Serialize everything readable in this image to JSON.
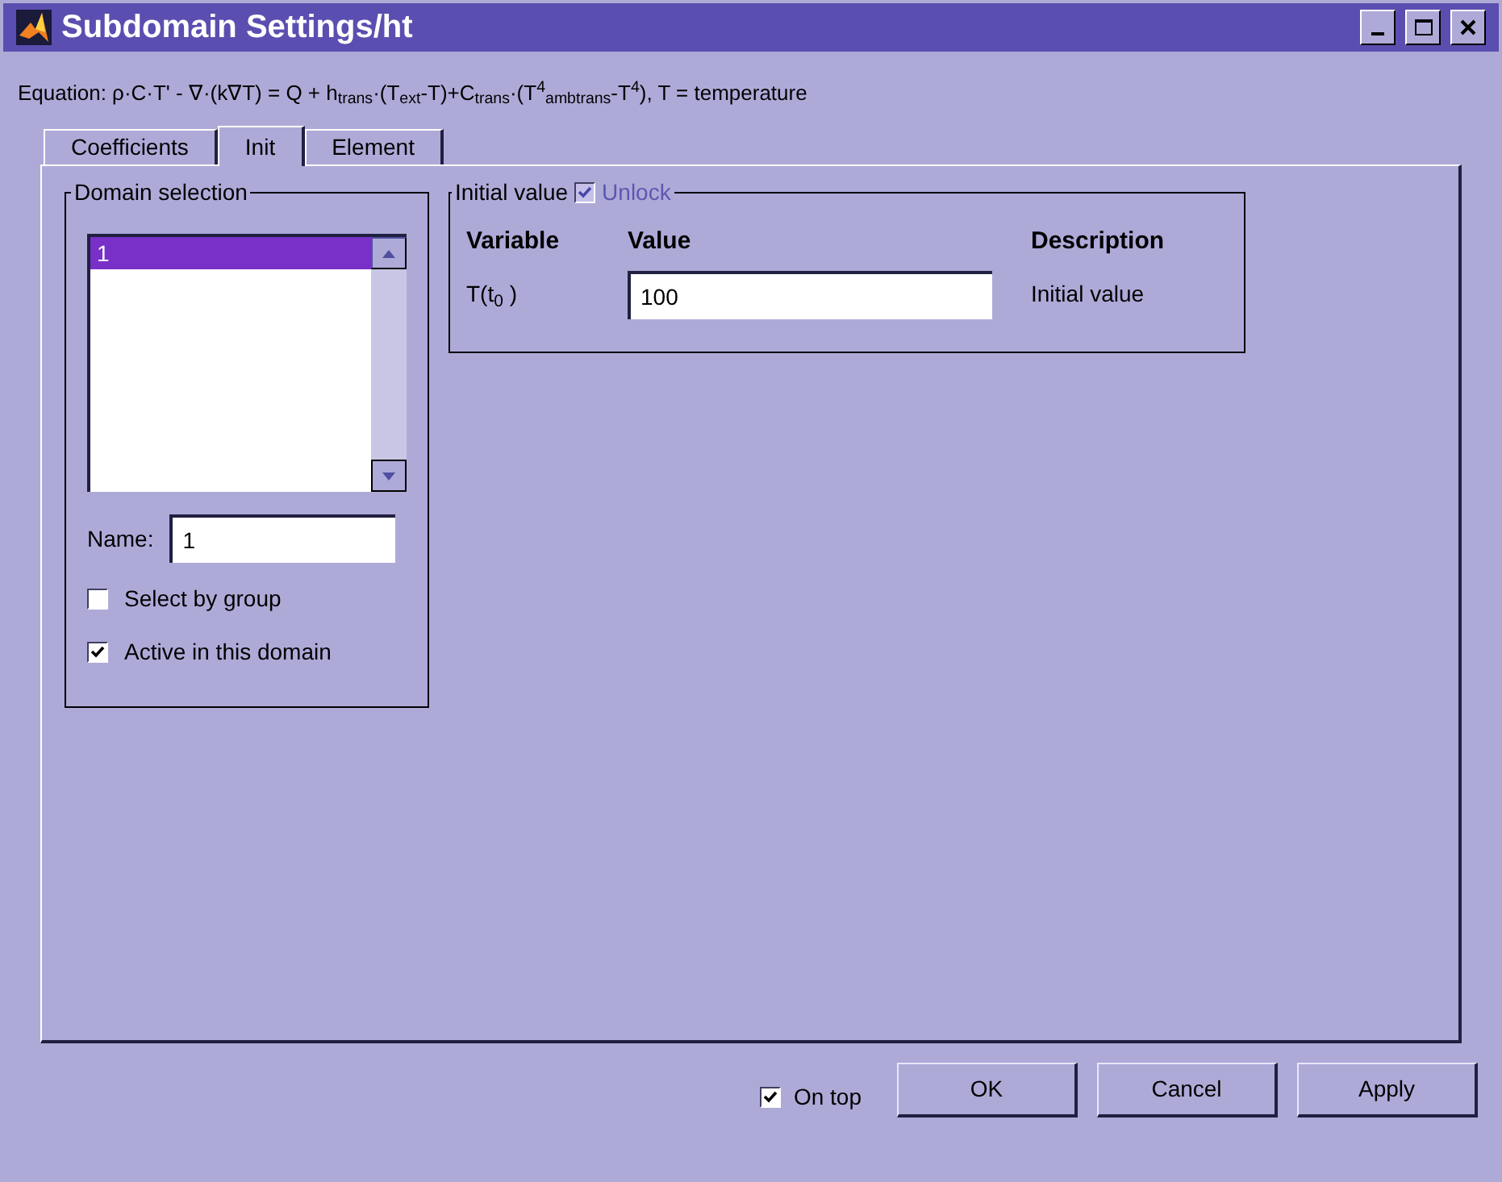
{
  "window": {
    "title": "Subdomain Settings/ht"
  },
  "equation": "Equation: ρ·C·T' - ∇·(k∇T) = Q + h$_{trans}$·(T$_{ext}$-T)+C$_{trans}$·(T$^{4}$$_{ambtrans}$-T$^{4}$), T = temperature",
  "tabs": [
    {
      "label": "Coefficients",
      "selected": false
    },
    {
      "label": "Init",
      "selected": true
    },
    {
      "label": "Element",
      "selected": false
    }
  ],
  "domain_selection": {
    "title": "Domain selection",
    "items": [
      {
        "label": "1",
        "selected": true
      }
    ],
    "name_label": "Name:",
    "name_value": "1",
    "checkboxes": [
      {
        "label": "Select by group",
        "checked": false
      },
      {
        "label": "Active in this domain",
        "checked": true
      }
    ]
  },
  "initial_value": {
    "title": "Initial value",
    "unlock": {
      "label": "Unlock",
      "checked": true,
      "disabled": true
    },
    "columns": [
      "Variable",
      "Value",
      "Description"
    ],
    "rows": [
      {
        "variable": "T(t$_{0}$ )",
        "value": "100",
        "description": "Initial value"
      }
    ]
  },
  "on_top": {
    "label": "On top",
    "checked": true
  },
  "buttons": [
    "OK",
    "Cancel",
    "Apply"
  ]
}
